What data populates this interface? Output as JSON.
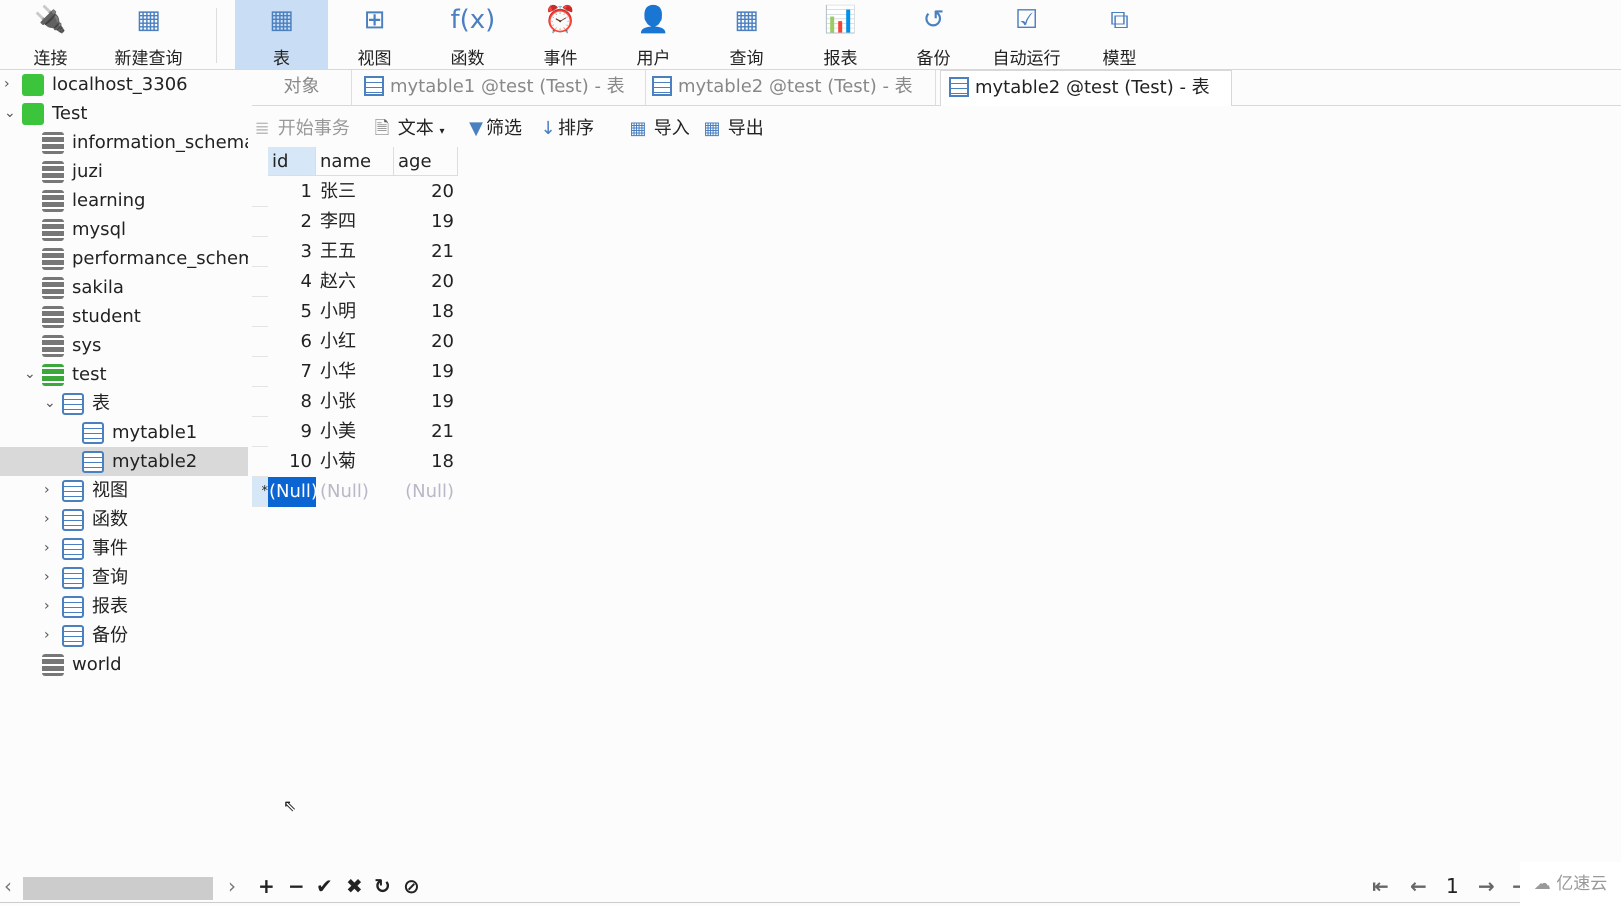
{
  "toolbar": {
    "items": [
      {
        "label": "连接",
        "icon": "plug-icon"
      },
      {
        "label": "新建查询",
        "icon": "new-query-icon"
      },
      {
        "label": "表",
        "icon": "table-icon",
        "active": true
      },
      {
        "label": "视图",
        "icon": "view-icon"
      },
      {
        "label": "函数",
        "icon": "function-icon",
        "glyph": "f(x)"
      },
      {
        "label": "事件",
        "icon": "clock-icon"
      },
      {
        "label": "用户",
        "icon": "user-icon"
      },
      {
        "label": "查询",
        "icon": "query-icon"
      },
      {
        "label": "报表",
        "icon": "report-icon"
      },
      {
        "label": "备份",
        "icon": "backup-icon"
      },
      {
        "label": "自动运行",
        "icon": "schedule-icon"
      },
      {
        "label": "模型",
        "icon": "model-icon"
      }
    ]
  },
  "sidebar": {
    "items": [
      {
        "label": "localhost_3306",
        "type": "server",
        "level": 0,
        "chev": "›"
      },
      {
        "label": "Test",
        "type": "server",
        "level": 0,
        "chev": "⌄"
      },
      {
        "label": "information_schema",
        "type": "db",
        "level": 1
      },
      {
        "label": "juzi",
        "type": "db",
        "level": 1
      },
      {
        "label": "learning",
        "type": "db",
        "level": 1
      },
      {
        "label": "mysql",
        "type": "db",
        "level": 1
      },
      {
        "label": "performance_schema",
        "type": "db",
        "level": 1
      },
      {
        "label": "sakila",
        "type": "db",
        "level": 1
      },
      {
        "label": "student",
        "type": "db",
        "level": 1
      },
      {
        "label": "sys",
        "type": "db",
        "level": 1
      },
      {
        "label": "test",
        "type": "db-open",
        "level": 1,
        "chev": "⌄"
      },
      {
        "label": "表",
        "type": "table",
        "level": 2,
        "chev": "⌄"
      },
      {
        "label": "mytable1",
        "type": "table",
        "level": 3
      },
      {
        "label": "mytable2",
        "type": "table",
        "level": 3,
        "selected": true
      },
      {
        "label": "视图",
        "type": "view",
        "level": 2,
        "chev": "›"
      },
      {
        "label": "函数",
        "type": "function",
        "level": 2,
        "chev": "›"
      },
      {
        "label": "事件",
        "type": "event",
        "level": 2,
        "chev": "›"
      },
      {
        "label": "查询",
        "type": "query",
        "level": 2,
        "chev": "›"
      },
      {
        "label": "报表",
        "type": "report",
        "level": 2,
        "chev": "›"
      },
      {
        "label": "备份",
        "type": "backup",
        "level": 2,
        "chev": "›"
      },
      {
        "label": "world",
        "type": "db",
        "level": 1
      }
    ]
  },
  "tabs": [
    {
      "label": "对象"
    },
    {
      "label": "mytable1 @test (Test) - 表"
    },
    {
      "label": "mytable2 @test (Test) - 表"
    },
    {
      "label": "mytable2 @test (Test) - 表",
      "active": true
    }
  ],
  "subtoolbar": {
    "begin_tx": "开始事务",
    "text": "文本",
    "filter": "筛选",
    "sort": "排序",
    "import": "导入",
    "export": "导出"
  },
  "grid": {
    "columns": [
      "id",
      "name",
      "age"
    ],
    "rows": [
      [
        "1",
        "张三",
        "20"
      ],
      [
        "2",
        "李四",
        "19"
      ],
      [
        "3",
        "王五",
        "21"
      ],
      [
        "4",
        "赵六",
        "20"
      ],
      [
        "5",
        "小明",
        "18"
      ],
      [
        "6",
        "小红",
        "20"
      ],
      [
        "7",
        "小华",
        "19"
      ],
      [
        "8",
        "小张",
        "19"
      ],
      [
        "9",
        "小美",
        "21"
      ],
      [
        "10",
        "小菊",
        "18"
      ]
    ],
    "new_row": [
      "(Null)",
      "(Null)",
      "(Null)"
    ],
    "new_row_marker": "*"
  },
  "pager": {
    "page": "1"
  },
  "watermark": "亿速云",
  "colors": {
    "accent": "#4a7fc0",
    "active_tab": "#c9def5",
    "selection": "#0a64d2"
  }
}
